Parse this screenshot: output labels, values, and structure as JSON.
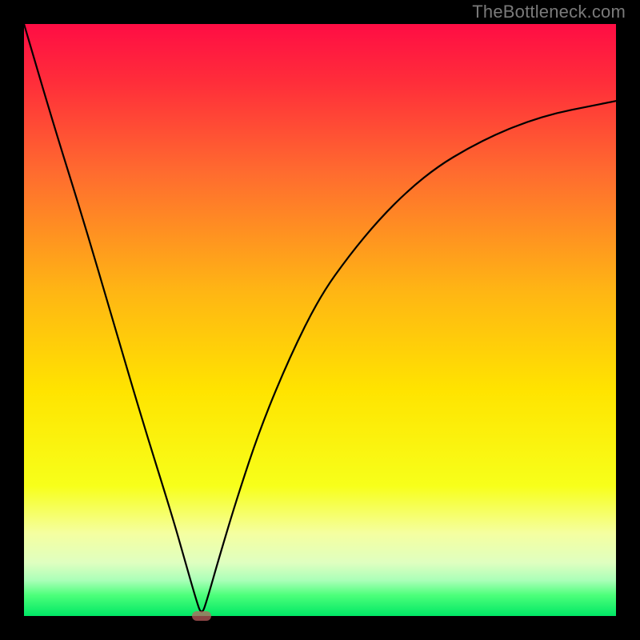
{
  "watermark": "TheBottleneck.com",
  "chart_data": {
    "type": "line",
    "title": "",
    "xlabel": "",
    "ylabel": "",
    "xlim": [
      0,
      100
    ],
    "ylim": [
      0,
      100
    ],
    "grid": false,
    "legend": false,
    "series": [
      {
        "name": "curve",
        "x": [
          0,
          5,
          10,
          15,
          20,
          25,
          27,
          29,
          30,
          31,
          33,
          36,
          40,
          45,
          50,
          55,
          60,
          65,
          70,
          75,
          80,
          85,
          90,
          95,
          100
        ],
        "y": [
          100,
          83,
          67,
          50,
          33,
          17,
          10,
          3,
          0,
          3,
          10,
          20,
          32,
          44,
          54,
          61,
          67,
          72,
          76,
          79,
          81.5,
          83.5,
          85,
          86,
          87
        ]
      }
    ],
    "marker": {
      "x": 30,
      "y": 0
    },
    "gradient_stops": [
      {
        "offset": 0.0,
        "color": "#ff0d44"
      },
      {
        "offset": 0.1,
        "color": "#ff2e3a"
      },
      {
        "offset": 0.25,
        "color": "#ff6b2f"
      },
      {
        "offset": 0.45,
        "color": "#ffb514"
      },
      {
        "offset": 0.62,
        "color": "#ffe400"
      },
      {
        "offset": 0.78,
        "color": "#f7ff1a"
      },
      {
        "offset": 0.86,
        "color": "#f5ffa0"
      },
      {
        "offset": 0.91,
        "color": "#dfffc0"
      },
      {
        "offset": 0.94,
        "color": "#aaffb8"
      },
      {
        "offset": 0.965,
        "color": "#4cff7a"
      },
      {
        "offset": 1.0,
        "color": "#00e765"
      }
    ]
  }
}
